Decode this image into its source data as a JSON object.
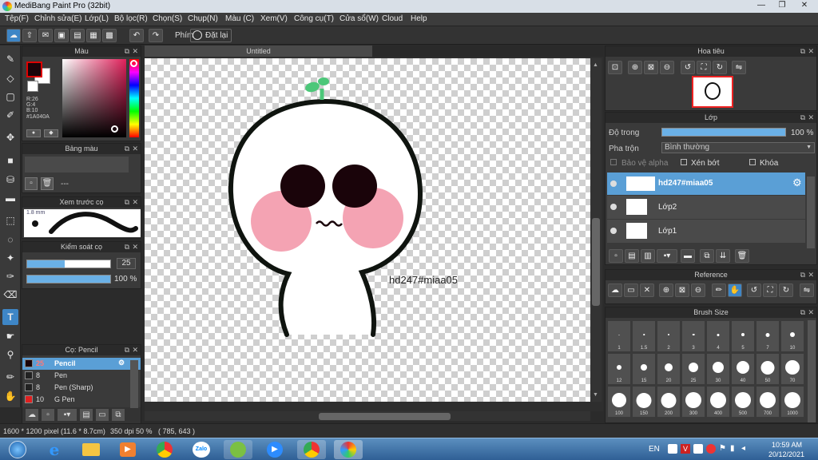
{
  "window": {
    "title": "MediBang Paint Pro (32bit)"
  },
  "menu": [
    "Tệp(F)",
    "Chỉnh sửa(E)",
    "Lớp(L)",
    "Bộ lọc(R)",
    "Chọn(S)",
    "Chụp(N)",
    "Màu (C)",
    "Xem(V)",
    "Công cụ(T)",
    "Cửa sổ(W)",
    "Cloud",
    "Help"
  ],
  "toolbar": {
    "shortcut_label": "Phím",
    "reset_label": "Đặt lại"
  },
  "color_panel": {
    "title": "Màu",
    "r": "R:26",
    "g": "G:4",
    "b": "B:10",
    "hex": "#1A040A",
    "primary": "#1a040a",
    "secondary": "#ffffff"
  },
  "palette_panel": {
    "title": "Bảng màu",
    "value": "---"
  },
  "brush_preview": {
    "title": "Xem trước cọ",
    "size": "1.8 mm"
  },
  "brush_control": {
    "title": "Kiểm soát cọ",
    "size": "25",
    "opacity": "100 %",
    "size_fraction": 0.45,
    "opacity_fraction": 1.0
  },
  "brush_list": {
    "title": "Cọ: Pencil",
    "items": [
      {
        "size": "25",
        "name": "Pencil",
        "selected": true
      },
      {
        "size": "8",
        "name": "Pen",
        "selected": false
      },
      {
        "size": "8",
        "name": "Pen (Sharp)",
        "selected": false
      },
      {
        "size": "10",
        "name": "G Pen",
        "selected": false
      }
    ]
  },
  "canvas": {
    "tab": "Untitled",
    "text": "hd247#miaa05"
  },
  "status": {
    "size": "1600 * 1200 pixel",
    "physical": "(11.6 * 8.7cm)",
    "dpi": "350 dpi",
    "zoom": "50 %",
    "coords": "( 785, 643 )"
  },
  "navigator": {
    "title": "Hoa tiêu"
  },
  "layer_panel": {
    "title": "Lớp",
    "opacity_label": "Độ trong",
    "opacity_value": "100 %",
    "blend_label": "Pha trộn",
    "blend_value": "Bình thường",
    "protect_alpha": "Bảo vệ alpha",
    "clipping": "Xén bớt",
    "lock": "Khóa",
    "layers": [
      {
        "name": "hd247#miaa05",
        "selected": true
      },
      {
        "name": "Lớp2",
        "selected": false
      },
      {
        "name": "Lớp1",
        "selected": false
      }
    ]
  },
  "reference": {
    "title": "Reference"
  },
  "brush_size": {
    "title": "Brush Size",
    "sizes": [
      "1",
      "1.5",
      "2",
      "3",
      "4",
      "5",
      "7",
      "10",
      "12",
      "15",
      "20",
      "25",
      "30",
      "40",
      "50",
      "70",
      "100",
      "150",
      "200",
      "300",
      "400",
      "500",
      "700",
      "1000"
    ]
  },
  "taskbar": {
    "lang": "EN",
    "time": "10:59 AM",
    "date": "20/12/2021",
    "zalo": "Zalo"
  }
}
